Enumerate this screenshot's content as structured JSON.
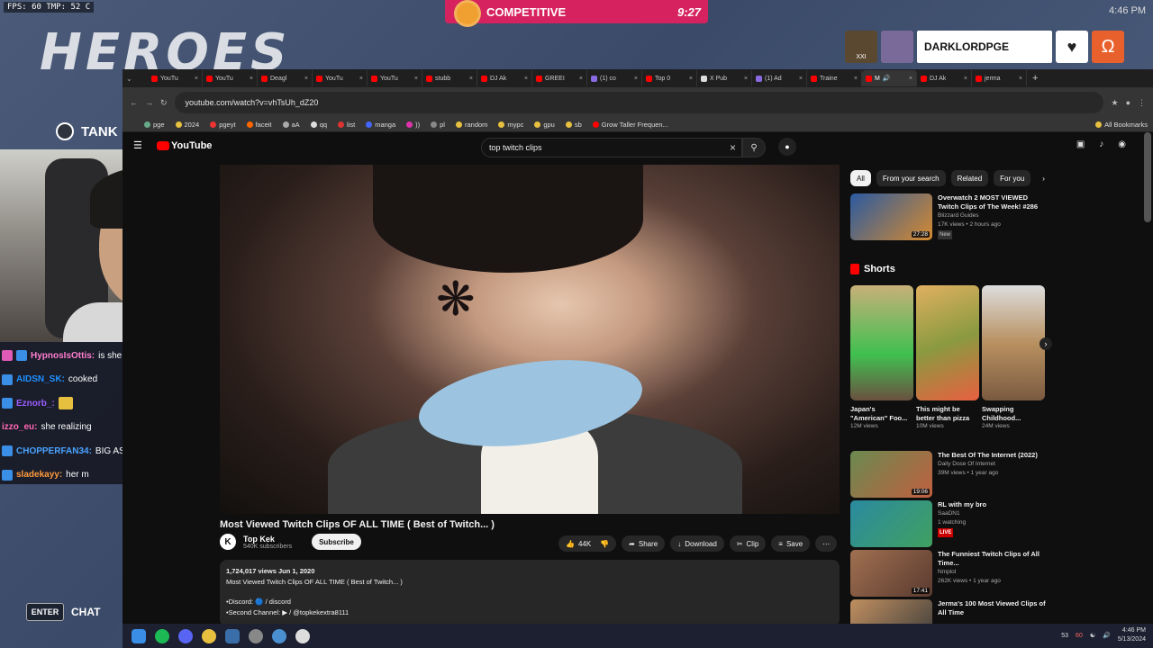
{
  "overlay": {
    "fps": "FPS:  60     TMP:  52 C",
    "competitive_label": "COMPETITIVE",
    "competitive_time": "9:27",
    "top_clock": "4:46 PM",
    "heroes": "HEROES",
    "tank": "TANK",
    "player_level": "XXI",
    "player_name": "DARKLORDPGE",
    "enter": "ENTER",
    "chat": "CHAT"
  },
  "chat": [
    {
      "user": "HypnosIsOttis:",
      "msg": "is she crying LOL",
      "color": "#ff7fcf"
    },
    {
      "user": "AIDSN_SK:",
      "msg": "cooked",
      "color": "#1e90ff"
    },
    {
      "user": "Eznorb_:",
      "msg": "",
      "color": "#9b5cff"
    },
    {
      "user": "izzo_eu:",
      "msg": "she realizing",
      "color": "#ff69b4"
    },
    {
      "user": "CHOPPERFAN34:",
      "msg": "BIG ASS HAND",
      "color": "#4aa3ff"
    },
    {
      "user": "sladekayy:",
      "msg": "her m",
      "color": "#ff9a3c"
    }
  ],
  "browser": {
    "tabs": [
      "YouTu",
      "YouTu",
      "Deagl",
      "YouTu",
      "YouTu",
      "stubb",
      "DJ Ak",
      "GREEI",
      "(1) co",
      "Top 0",
      "X Pub",
      "(1) Ad",
      "Traine",
      "M",
      "DJ Ak",
      "jerma"
    ],
    "url": "youtube.com/watch?v=vhTsUh_dZ20",
    "bookmarks": [
      "pge",
      "2024",
      "pgeyt",
      "faceit",
      "aA",
      "qq",
      "list",
      "manga",
      "))",
      "pl",
      "random",
      "mypc",
      "gpu",
      "sb",
      "Grow Taller Frequen..."
    ],
    "all_bookmarks": "All Bookmarks"
  },
  "youtube": {
    "logo": "YouTube",
    "search": "top twitch clips",
    "video_title": "Most Viewed Twitch Clips OF ALL TIME ( Best of Twitch... )",
    "channel_name": "Top Kek",
    "channel_subs": "540K subscribers",
    "subscribe": "Subscribe",
    "likes": "44K",
    "share": "Share",
    "download": "Download",
    "clip": "Clip",
    "save": "Save",
    "desc_stats": "1,724,017 views  Jun 1, 2020",
    "desc_title": "Most Viewed Twitch Clips OF ALL TIME ( Best of Twitch... )",
    "desc_discord": "•Discord:  🔵 / discord",
    "desc_second": "•Second Channel:  ▶ / @topkekextra8111",
    "chips": [
      "All",
      "From your search",
      "Related",
      "For you"
    ],
    "shorts_header": "Shorts",
    "recs": [
      {
        "title": "Overwatch 2 MOST VIEWED Twitch Clips of The Week! #286",
        "channel": "Blizzard Guides",
        "meta": "17K views • 2 hours ago",
        "dur": "27:28",
        "badge": "New"
      },
      {
        "title": "The Best Of The Internet (2022)",
        "channel": "Daily Dose Of Internet",
        "meta": "39M views • 1 year ago",
        "dur": "19:06",
        "badge": ""
      },
      {
        "title": "RL with my bro",
        "channel": "SaaDN1",
        "meta": "1 watching",
        "dur": "",
        "badge": "LIVE"
      },
      {
        "title": "The Funniest Twitch Clips of All Time...",
        "channel": "Nmplol",
        "meta": "262K views • 1 year ago",
        "dur": "17:41",
        "badge": ""
      },
      {
        "title": "Jerma's 100 Most Viewed Clips of All Time",
        "channel": "",
        "meta": "",
        "dur": "",
        "badge": ""
      }
    ],
    "shorts": [
      {
        "title": "Japan's \"American\" Foo...",
        "views": "12M views"
      },
      {
        "title": "This might be better than pizza",
        "views": "10M views"
      },
      {
        "title": "Swapping Childhood...",
        "views": "24M views"
      }
    ]
  },
  "taskbar": {
    "time": "4:46 PM",
    "date": "5/13/2024",
    "tray1": "53",
    "tray2": "60"
  }
}
